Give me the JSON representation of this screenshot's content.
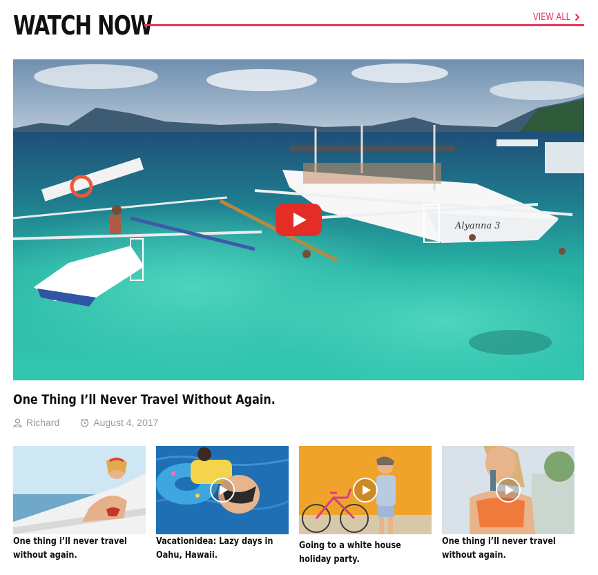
{
  "section": {
    "title": "WATCH NOW",
    "view_all": "VIEW ALL",
    "accent_color": "#e8345b"
  },
  "featured": {
    "title": "One Thing I’ll Never Travel Without Again.",
    "author": "Richard",
    "date": "August 4, 2017",
    "author_icon": "user-icon",
    "date_icon": "clock-icon",
    "play_icon": "youtube-play-icon",
    "boat_name": "Alyanna 3"
  },
  "videos": [
    {
      "title": "One thing i’ll never travel without again.",
      "has_play": false
    },
    {
      "title": "Vacationidea: Lazy days in Oahu, Hawaii.",
      "has_play": true
    },
    {
      "title": "Going to a white house holiday party.",
      "has_play": true
    },
    {
      "title": "One thing i’ll never travel without again.",
      "has_play": true
    }
  ]
}
